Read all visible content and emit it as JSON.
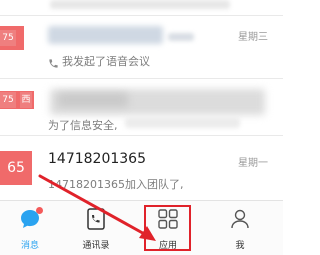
{
  "conversations": [
    {
      "tag": "",
      "weekday": "",
      "preview": "",
      "title": "",
      "avatar_text": ""
    },
    {
      "tag": "75",
      "weekday": "星期三",
      "preview": "我发起了语音会议",
      "title": "",
      "avatar_text": ""
    },
    {
      "tag": "75",
      "tag_extra": "西",
      "weekday": "",
      "preview": "为了信息安全,",
      "title": "",
      "avatar_text": ""
    },
    {
      "tag": "",
      "weekday": "星期一",
      "preview": "14718201365加入团队了,",
      "title": "14718201365",
      "avatar_text": "65"
    }
  ],
  "tabbar": {
    "tabs": [
      {
        "label": "消息",
        "icon": "message-icon",
        "active": true
      },
      {
        "label": "通讯录",
        "icon": "contacts-icon",
        "active": false
      },
      {
        "label": "应用",
        "icon": "apps-icon",
        "active": false
      },
      {
        "label": "我",
        "icon": "person-icon",
        "active": false
      }
    ]
  },
  "colors": {
    "accent": "#2aa3f0",
    "tag_red": "#ef7f7f",
    "avatar_red": "#f06a6a",
    "highlight_red": "#e0222a"
  }
}
